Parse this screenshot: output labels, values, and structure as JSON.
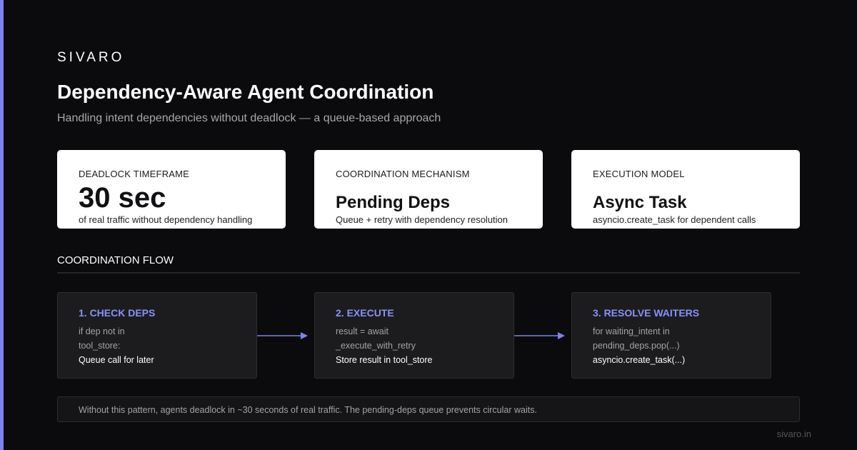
{
  "colors": {
    "background": "#0b0b0d",
    "accent": "#7b84f2",
    "card_bg": "#ffffff",
    "step_bg": "#1c1c1f",
    "step_title": "#8a91f6"
  },
  "brand": "SIVARO",
  "title": "Dependency-Aware Agent Coordination",
  "subtitle": "Handling intent dependencies without deadlock — a queue-based approach",
  "stats": [
    {
      "label": "DEADLOCK TIMEFRAME",
      "value": "30 sec",
      "description": "of real traffic without dependency handling"
    },
    {
      "label": "COORDINATION MECHANISM",
      "value": "Pending Deps",
      "description": "Queue + retry with dependency resolution"
    },
    {
      "label": "EXECUTION MODEL",
      "value": "Async Task",
      "description": "asyncio.create_task for dependent calls"
    }
  ],
  "flow": {
    "section_title": "COORDINATION FLOW",
    "steps": [
      {
        "title": "1. CHECK DEPS",
        "lines": [
          "if dep not in",
          "tool_store:",
          "Queue call for later"
        ]
      },
      {
        "title": "2. EXECUTE",
        "lines": [
          "result = await",
          "_execute_with_retry",
          "Store result in tool_store"
        ]
      },
      {
        "title": "3. RESOLVE WAITERS",
        "lines": [
          "for waiting_intent in",
          "pending_deps.pop(...)",
          "asyncio.create_task(...)"
        ]
      }
    ],
    "arrow_icon": "arrow-right-icon"
  },
  "note": "Without this pattern, agents deadlock in ~30 seconds of real traffic. The pending-deps queue prevents circular waits.",
  "footer_url": "sivaro.in"
}
